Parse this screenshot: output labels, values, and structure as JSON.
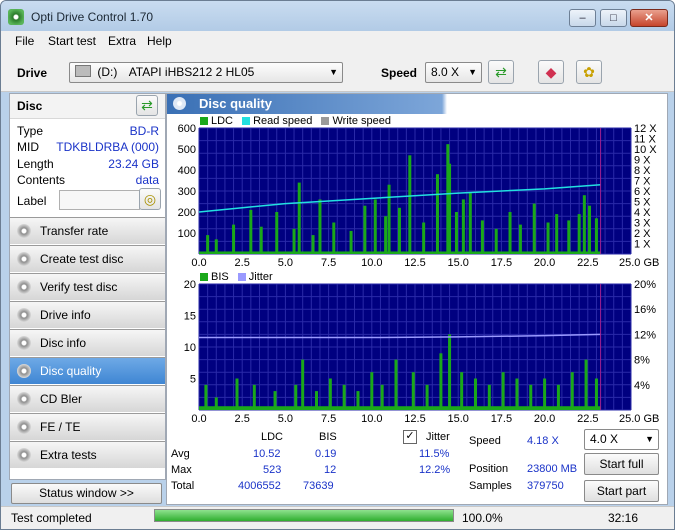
{
  "window": {
    "title": "Opti Drive Control 1.70"
  },
  "menu": [
    "File",
    "Start test",
    "Extra",
    "Help"
  ],
  "toolbar": {
    "drive_label": "Drive",
    "drive_letter": "(D:)",
    "drive_name": "ATAPI iHBS212   2 HL05",
    "speed_label": "Speed",
    "speed_value": "8.0 X"
  },
  "disc": {
    "header": "Disc",
    "rows": [
      {
        "k": "Type",
        "v": "BD-R"
      },
      {
        "k": "MID",
        "v": "TDKBLDRBA (000)"
      },
      {
        "k": "Length",
        "v": "23.24 GB"
      },
      {
        "k": "Contents",
        "v": "data"
      }
    ],
    "label_label": "Label",
    "label_value": ""
  },
  "nav": [
    {
      "label": "Transfer rate",
      "active": false
    },
    {
      "label": "Create test disc",
      "active": false
    },
    {
      "label": "Verify test disc",
      "active": false
    },
    {
      "label": "Drive info",
      "active": false
    },
    {
      "label": "Disc info",
      "active": false
    },
    {
      "label": "Disc quality",
      "active": true
    },
    {
      "label": "CD Bler",
      "active": false
    },
    {
      "label": "FE / TE",
      "active": false
    },
    {
      "label": "Extra tests",
      "active": false
    }
  ],
  "status_window_label": "Status window >>",
  "panel_title": "Disc quality",
  "chart_data": [
    {
      "type": "bar",
      "legend": [
        "LDC",
        "Read speed",
        "Write speed"
      ],
      "x_ticks": [
        "0.0",
        "2.5",
        "5.0",
        "7.5",
        "10.0",
        "12.5",
        "15.0",
        "17.5",
        "20.0",
        "22.5",
        "25.0 GB"
      ],
      "xlim": [
        0,
        25
      ],
      "y_ticks_left": [
        "600",
        "500",
        "400",
        "300",
        "200",
        "100"
      ],
      "ylim_left": [
        0,
        600
      ],
      "y_ticks_right": [
        "12 X",
        "11 X",
        "10 X",
        "9 X",
        "8 X",
        "7 X",
        "6 X",
        "5 X",
        "4 X",
        "3 X",
        "2 X",
        "1 X"
      ],
      "ylim_right": [
        0,
        12
      ],
      "ldc_x": [
        0.5,
        1.0,
        2.0,
        3.0,
        3.6,
        4.5,
        5.5,
        5.8,
        6.6,
        7.0,
        7.8,
        8.8,
        9.6,
        10.2,
        10.8,
        11.0,
        11.6,
        12.2,
        13.0,
        13.8,
        14.4,
        14.5,
        14.9,
        15.3,
        15.7,
        16.4,
        17.2,
        18.0,
        18.6,
        19.4,
        20.2,
        20.7,
        21.4,
        22.0,
        22.3,
        22.6,
        23.0
      ],
      "ldc": [
        90,
        70,
        140,
        210,
        130,
        200,
        120,
        340,
        90,
        260,
        150,
        110,
        230,
        260,
        180,
        330,
        220,
        470,
        150,
        380,
        523,
        430,
        200,
        260,
        290,
        160,
        120,
        200,
        140,
        240,
        150,
        190,
        160,
        190,
        280,
        230,
        170
      ],
      "read_speed": [
        [
          0,
          4.0
        ],
        [
          5,
          4.8
        ],
        [
          10,
          5.3
        ],
        [
          15,
          5.8
        ],
        [
          20,
          6.2
        ],
        [
          23.24,
          6.6
        ]
      ]
    },
    {
      "type": "bar",
      "legend": [
        "BIS",
        "Jitter"
      ],
      "x_ticks": [
        "0.0",
        "2.5",
        "5.0",
        "7.5",
        "10.0",
        "12.5",
        "15.0",
        "17.5",
        "20.0",
        "22.5",
        "25.0 GB"
      ],
      "xlim": [
        0,
        25
      ],
      "y_ticks_left": [
        "20",
        "15",
        "10",
        "5"
      ],
      "ylim_left": [
        0,
        20
      ],
      "y_ticks_right": [
        "20%",
        "16%",
        "12%",
        "8%",
        "4%"
      ],
      "ylim_right": [
        0,
        20
      ],
      "bis_x": [
        0.4,
        1.0,
        2.2,
        3.2,
        4.4,
        5.6,
        6.0,
        6.8,
        7.6,
        8.4,
        9.2,
        10.0,
        10.6,
        11.4,
        12.4,
        13.2,
        14.0,
        14.5,
        15.2,
        16.0,
        16.8,
        17.6,
        18.4,
        19.2,
        20.0,
        20.8,
        21.6,
        22.4,
        23.0
      ],
      "bis": [
        4,
        2,
        5,
        4,
        3,
        4,
        8,
        3,
        5,
        4,
        3,
        6,
        4,
        8,
        6,
        4,
        9,
        12,
        6,
        5,
        4,
        6,
        5,
        4,
        5,
        4,
        6,
        8,
        5
      ],
      "jitter": [
        [
          0,
          11.5
        ],
        [
          5,
          11.5
        ],
        [
          10,
          11.5
        ],
        [
          15,
          11.6
        ],
        [
          20,
          11.8
        ],
        [
          23.24,
          12.0
        ]
      ]
    }
  ],
  "stats": {
    "col_headers": [
      "LDC",
      "BIS",
      "Jitter"
    ],
    "jitter_checked": true,
    "rows": [
      {
        "label": "Avg",
        "ldc": "10.52",
        "bis": "0.19",
        "jitter": "11.5%"
      },
      {
        "label": "Max",
        "ldc": "523",
        "bis": "12",
        "jitter": "12.2%"
      },
      {
        "label": "Total",
        "ldc": "4006552",
        "bis": "73639",
        "jitter": ""
      }
    ],
    "speed_label": "Speed",
    "speed_value": "4.18 X",
    "position_label": "Position",
    "position_value": "23800 MB",
    "samples_label": "Samples",
    "samples_value": "379750",
    "speed_select": "4.0 X",
    "start_full": "Start full",
    "start_part": "Start part"
  },
  "status": {
    "text": "Test completed",
    "progress_pct": 100,
    "progress_text": "100.0%",
    "time": "32:16"
  },
  "colors": {
    "ldc": "#1aa81a",
    "bis": "#1aa81a",
    "read_speed": "#22e0e0",
    "write_speed": "#9a9a9a",
    "jitter": "#9a9aff",
    "plot_bg": "#000080",
    "plot_grid": "#2a2aa8"
  }
}
